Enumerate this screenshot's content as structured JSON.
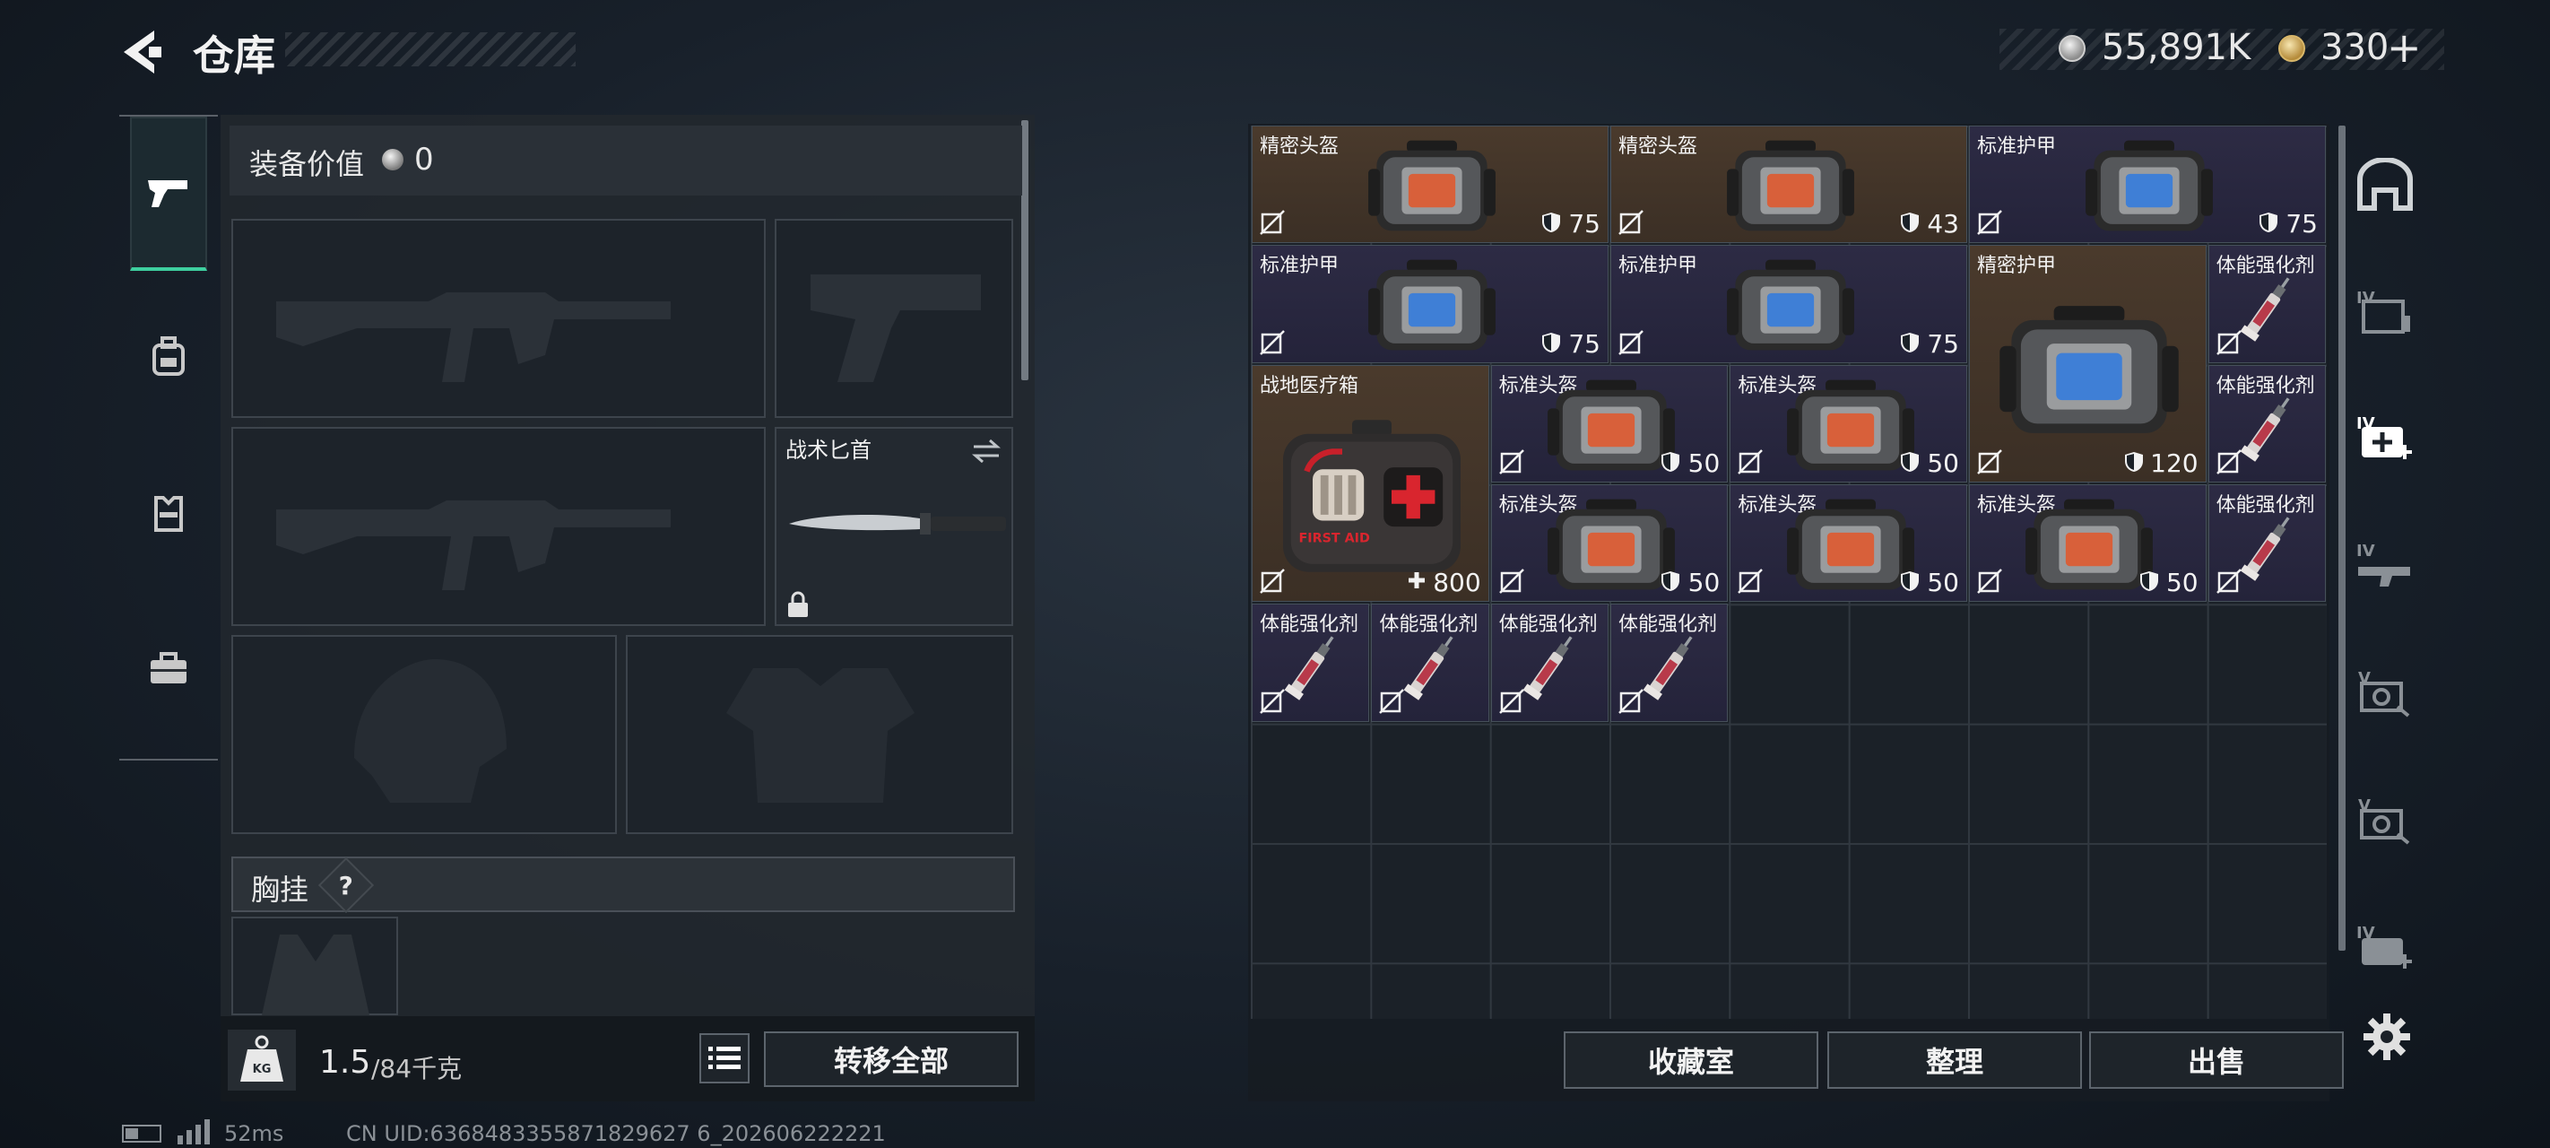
{
  "header": {
    "title": "仓库",
    "currency_silver": "55,891K",
    "currency_gold": "330",
    "currency_add": "+"
  },
  "loadout": {
    "value_label": "装备价值",
    "value": "0",
    "knife_slot_label": "战术匕首",
    "chest_label": "胸挂",
    "chest_help": "?",
    "weight_current": "1.5",
    "weight_max": "/84千克",
    "transfer_all": "转移全部",
    "kg_icon_text": "KG"
  },
  "inventory": {
    "items": [
      {
        "name": "精密头盔",
        "value": "75",
        "kind": "helmet",
        "bg": "brown"
      },
      {
        "name": "精密头盔",
        "value": "43",
        "kind": "helmet",
        "bg": "brown"
      },
      {
        "name": "标准护甲",
        "value": "75",
        "kind": "armor",
        "bg": "purple"
      },
      {
        "name": "标准护甲",
        "value": "75",
        "kind": "armor",
        "bg": "purple"
      },
      {
        "name": "标准护甲",
        "value": "75",
        "kind": "armor",
        "bg": "purple"
      },
      {
        "name": "精密护甲",
        "value": "120",
        "kind": "armor-big",
        "bg": "brown"
      },
      {
        "name": "体能强化剂",
        "value": "",
        "kind": "syringe",
        "bg": "purple"
      },
      {
        "name": "体能强化剂",
        "value": "",
        "kind": "syringe",
        "bg": "purple"
      },
      {
        "name": "战地医疗箱",
        "value": "800",
        "kind": "medkit",
        "bg": "brown"
      },
      {
        "name": "标准头盔",
        "value": "50",
        "kind": "helmet",
        "bg": "purple"
      },
      {
        "name": "标准头盔",
        "value": "50",
        "kind": "helmet",
        "bg": "purple"
      },
      {
        "name": "体能强化剂",
        "value": "",
        "kind": "syringe",
        "bg": "purple"
      },
      {
        "name": "标准头盔",
        "value": "50",
        "kind": "helmet",
        "bg": "purple"
      },
      {
        "name": "标准头盔",
        "value": "50",
        "kind": "helmet",
        "bg": "purple"
      },
      {
        "name": "标准头盔",
        "value": "50",
        "kind": "helmet",
        "bg": "purple"
      },
      {
        "name": "体能强化剂",
        "value": "",
        "kind": "syringe",
        "bg": "purple"
      },
      {
        "name": "体能强化剂",
        "value": "",
        "kind": "syringe",
        "bg": "purple"
      },
      {
        "name": "体能强化剂",
        "value": "",
        "kind": "syringe",
        "bg": "purple"
      },
      {
        "name": "体能强化剂",
        "value": "",
        "kind": "syringe",
        "bg": "purple"
      }
    ],
    "medkit_text": "FIRST AID"
  },
  "actions": {
    "collection": "收藏室",
    "sort": "整理",
    "sell": "出售"
  },
  "status": {
    "ping": "52ms",
    "uid": "CN UID:6368483355871829627 6_202606222221"
  },
  "category_rail": {
    "labels": [
      "IV",
      "IV",
      "IV",
      "V",
      "V",
      "IV"
    ]
  }
}
